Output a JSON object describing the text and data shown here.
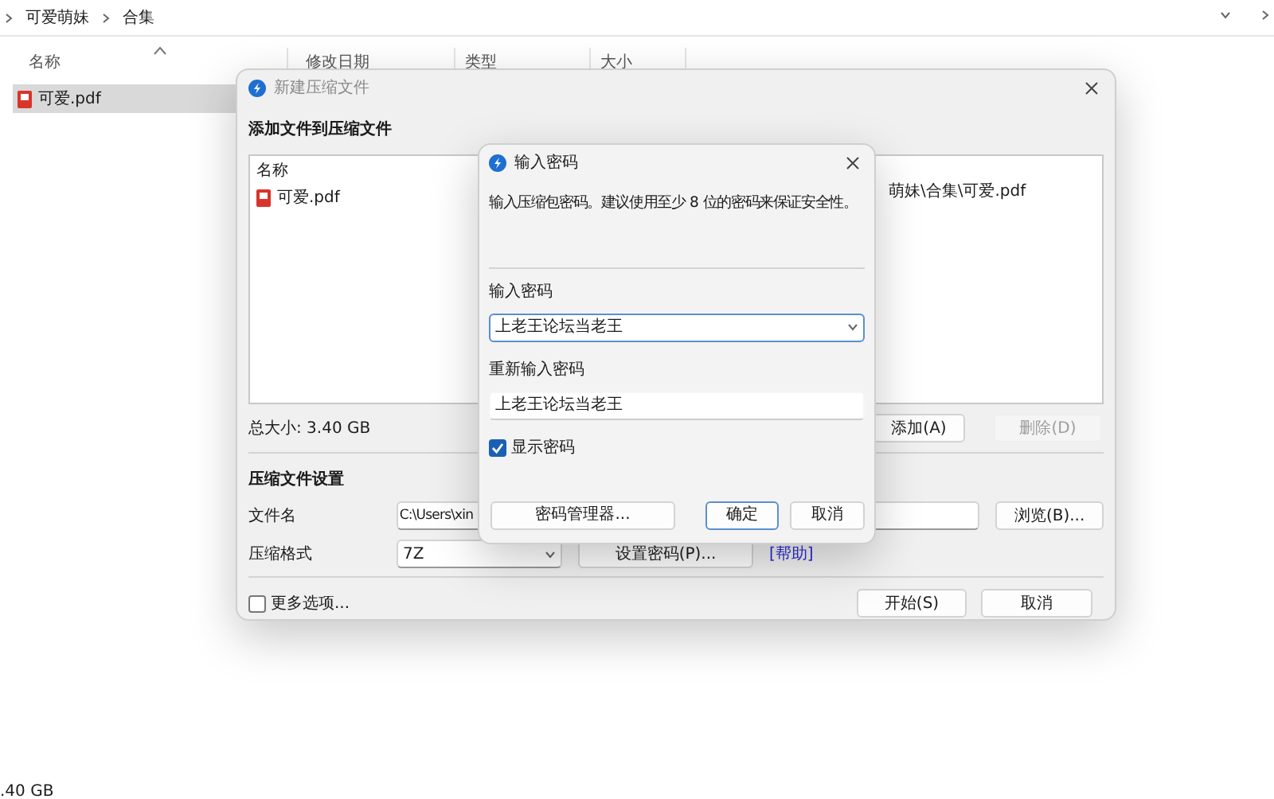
{
  "explorer": {
    "breadcrumb": [
      "可爱萌妹",
      "合集"
    ],
    "columns": [
      "名称",
      "修改日期",
      "类型",
      "大小"
    ],
    "files": [
      {
        "name": "可爱.pdf",
        "selected": true
      }
    ],
    "status": ".40 GB"
  },
  "compress_dialog": {
    "title": "新建压缩文件",
    "active": false,
    "files_heading": "添加文件到压缩文件",
    "list_columns": [
      "名称"
    ],
    "list_rows": [
      {
        "name": "可爱.pdf",
        "path": "萌妹\\合集\\可爱.pdf"
      }
    ],
    "total_size": "总大小: 3.40 GB",
    "list_buttons": [
      {
        "label": "添加(A)",
        "disabled": false
      },
      {
        "label": "删除(D)",
        "disabled": true
      }
    ],
    "settings_heading": "压缩文件设置",
    "file_name": {
      "label": "文件名",
      "value": "C:\\Users\\xin",
      "button": "浏览(B)..."
    },
    "format": {
      "label": "压缩格式",
      "value": "7Z",
      "button": "设置密码(P)...",
      "help_link": "[帮助]"
    },
    "more_options": {
      "label": "更多选项...",
      "checked": false
    },
    "buttons": [
      {
        "label": "开始(S)"
      },
      {
        "label": "取消"
      }
    ]
  },
  "password_dialog": {
    "title": "输入密码",
    "active": true,
    "hint": "输入压缩包密码。建议使用至少 8 位的密码来保证安全性。",
    "password_label": "输入密码",
    "password": "上老王论坛当老王",
    "repeat_label": "重新输入密码",
    "repeat": "上老王论坛当老王",
    "show_password": {
      "label": "显示密码",
      "checked": true
    },
    "buttons": [
      {
        "label": "密码管理器...",
        "default": false
      },
      {
        "label": "确定",
        "default": true
      },
      {
        "label": "取消",
        "default": false
      }
    ]
  }
}
